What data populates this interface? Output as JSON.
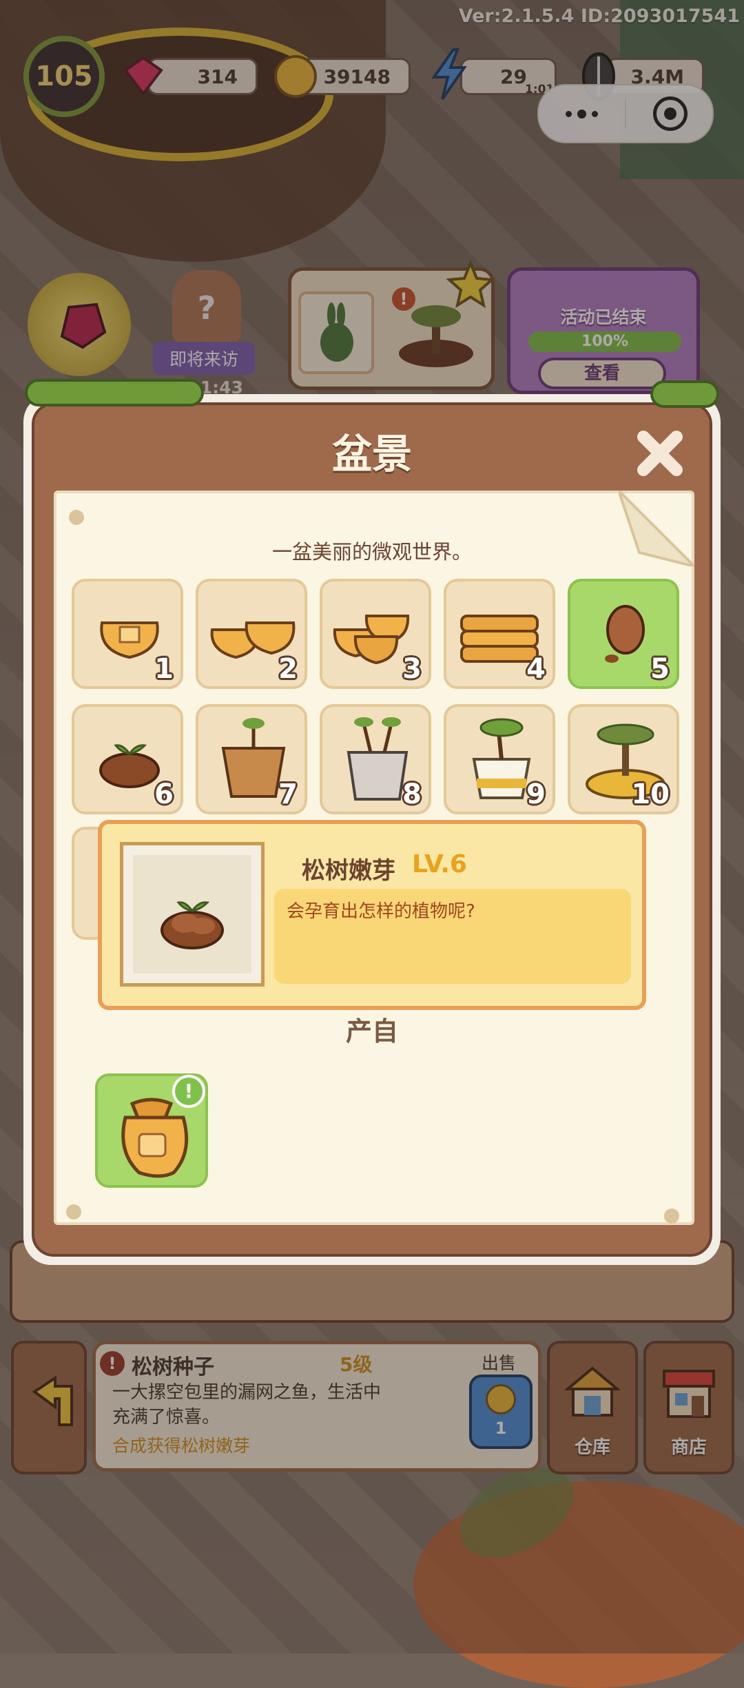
{
  "version_text": "Ver:2.1.5.4 ID:2093017541",
  "hud": {
    "level": "105",
    "gems": "314",
    "coins": "39148",
    "energy": "29",
    "energy_timer": "1:01",
    "seeds": "3.4M"
  },
  "top_cards": {
    "visitor_label": "即将来访",
    "visitor_timer": "2:21:43",
    "event_status": "活动已结束",
    "event_progress": 1.0,
    "event_progress_text": "100%",
    "event_button": "查看"
  },
  "dialog": {
    "title": "盆景",
    "subtitle": "一盆美丽的微观世界。",
    "selected_index": 5,
    "items": [
      {
        "num": "1",
        "icon": "seed-bag-icon"
      },
      {
        "num": "2",
        "icon": "seed-bags-icon"
      },
      {
        "num": "3",
        "icon": "seed-bags-pile-icon"
      },
      {
        "num": "4",
        "icon": "seed-bag-stack-icon"
      },
      {
        "num": "5",
        "icon": "pinecone-icon"
      },
      {
        "num": "6",
        "icon": "pine-sprout-icon"
      },
      {
        "num": "7",
        "icon": "wooden-pot-sapling-icon"
      },
      {
        "num": "8",
        "icon": "stone-pot-sapling-icon"
      },
      {
        "num": "9",
        "icon": "white-pot-bonsai-icon"
      },
      {
        "num": "10",
        "icon": "golden-pot-bonsai-icon"
      }
    ],
    "tooltip": {
      "name": "松树嫩芽",
      "level": "LV.6",
      "description": "会孕育出怎样的植物呢?"
    },
    "produce_label": "产自",
    "produce_item_icon": "seed-sack-icon",
    "produce_badge": "!"
  },
  "bottom_panel": {
    "item_name": "松树种子",
    "item_level": "5级",
    "description": "一大摞空包里的漏网之鱼，生活中充满了惊喜。",
    "hint": "合成获得松树嫩芽",
    "sell_label": "出售",
    "sell_price": "1",
    "warehouse_label": "仓库",
    "shop_label": "商店"
  },
  "colors": {
    "panel_brown": "#9f6a4c",
    "paper": "#fbf5e3",
    "tile": "#f1dfbd",
    "selected_tile": "#a8d86a",
    "tooltip_orange": "#f0b463",
    "level_text": "#e8a21e"
  }
}
